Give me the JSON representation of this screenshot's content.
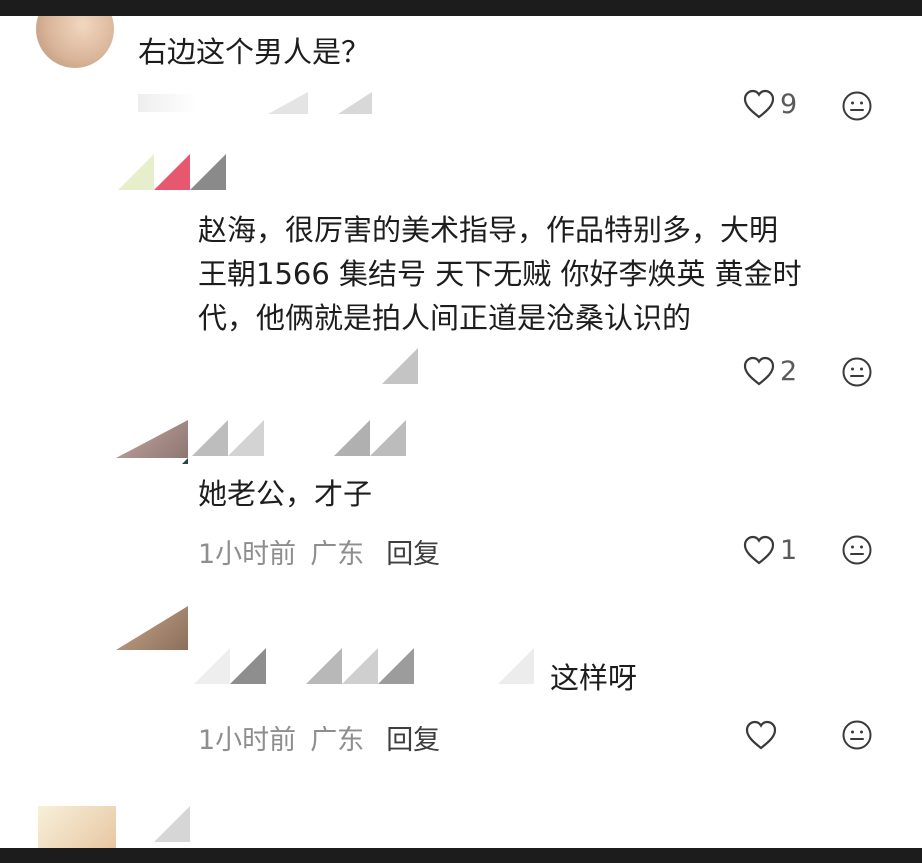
{
  "comments": [
    {
      "text": "右边这个男人是？",
      "likes": "9"
    },
    {
      "lines": [
        "赵海，很厉害的美术指导，作品特别多，大明",
        "王朝1566 集结号 天下无贼 你好李焕英 黄金时",
        "代，他俩就是拍人间正道是沧桑认识的"
      ],
      "likes": "2"
    },
    {
      "text": "她老公，才子",
      "time": "1小时前",
      "location": "广东",
      "reply": "回复",
      "likes": "1"
    },
    {
      "text": "这样呀",
      "time": "1小时前",
      "location": "广东",
      "reply": "回复",
      "likes": ""
    }
  ],
  "icons": {
    "heart": "heart-outline-icon",
    "emoji": "neutral-face-icon"
  },
  "colors": {
    "text": "#1d1d1d",
    "meta": "#8e8e8e",
    "icon": "#3a3a3a",
    "background": "#ffffff"
  }
}
